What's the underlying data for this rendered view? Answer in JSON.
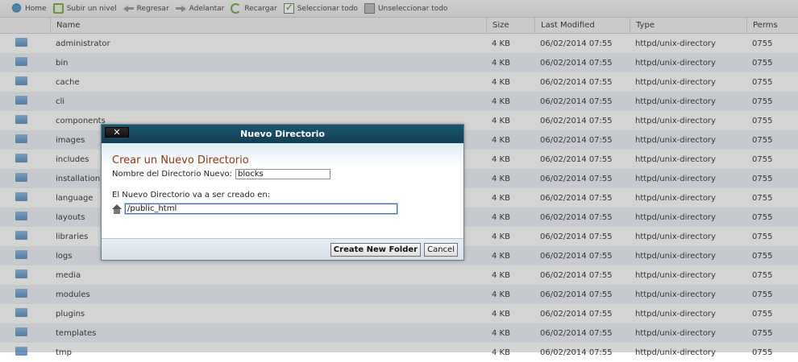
{
  "toolbar": {
    "items": [
      {
        "label": "Home",
        "icon": "home-icon"
      },
      {
        "label": "Subir un nivel",
        "icon": "up-level-icon"
      },
      {
        "label": "Regresar",
        "icon": "back-arrow-icon"
      },
      {
        "label": "Adelantar",
        "icon": "forward-arrow-icon"
      },
      {
        "label": "Recargar",
        "icon": "reload-icon"
      },
      {
        "label": "Seleccionar todo",
        "icon": "checkbox-checked-icon"
      },
      {
        "label": "Unseleccionar todo",
        "icon": "checkbox-unchecked-icon"
      }
    ]
  },
  "table": {
    "columns": [
      "Name",
      "Size",
      "Last Modified",
      "Type",
      "Perms"
    ],
    "rows": [
      {
        "name": "administrator",
        "size": "4 KB",
        "modified": "06/02/2014 07:55",
        "type": "httpd/unix-directory",
        "perms": "0755"
      },
      {
        "name": "bin",
        "size": "4 KB",
        "modified": "06/02/2014 07:55",
        "type": "httpd/unix-directory",
        "perms": "0755"
      },
      {
        "name": "cache",
        "size": "4 KB",
        "modified": "06/02/2014 07:55",
        "type": "httpd/unix-directory",
        "perms": "0755"
      },
      {
        "name": "cli",
        "size": "4 KB",
        "modified": "06/02/2014 07:55",
        "type": "httpd/unix-directory",
        "perms": "0755"
      },
      {
        "name": "components",
        "size": "4 KB",
        "modified": "06/02/2014 07:55",
        "type": "httpd/unix-directory",
        "perms": "0755"
      },
      {
        "name": "images",
        "size": "4 KB",
        "modified": "06/02/2014 07:55",
        "type": "httpd/unix-directory",
        "perms": "0755"
      },
      {
        "name": "includes",
        "size": "4 KB",
        "modified": "06/02/2014 07:55",
        "type": "httpd/unix-directory",
        "perms": "0755"
      },
      {
        "name": "installation",
        "size": "4 KB",
        "modified": "06/02/2014 07:55",
        "type": "httpd/unix-directory",
        "perms": "0755"
      },
      {
        "name": "language",
        "size": "4 KB",
        "modified": "06/02/2014 07:55",
        "type": "httpd/unix-directory",
        "perms": "0755"
      },
      {
        "name": "layouts",
        "size": "4 KB",
        "modified": "06/02/2014 07:55",
        "type": "httpd/unix-directory",
        "perms": "0755"
      },
      {
        "name": "libraries",
        "size": "4 KB",
        "modified": "06/02/2014 07:55",
        "type": "httpd/unix-directory",
        "perms": "0755"
      },
      {
        "name": "logs",
        "size": "4 KB",
        "modified": "06/02/2014 07:55",
        "type": "httpd/unix-directory",
        "perms": "0755"
      },
      {
        "name": "media",
        "size": "4 KB",
        "modified": "06/02/2014 07:55",
        "type": "httpd/unix-directory",
        "perms": "0755"
      },
      {
        "name": "modules",
        "size": "4 KB",
        "modified": "06/02/2014 07:55",
        "type": "httpd/unix-directory",
        "perms": "0755"
      },
      {
        "name": "plugins",
        "size": "4 KB",
        "modified": "06/02/2014 07:55",
        "type": "httpd/unix-directory",
        "perms": "0755"
      },
      {
        "name": "templates",
        "size": "4 KB",
        "modified": "06/02/2014 07:55",
        "type": "httpd/unix-directory",
        "perms": "0755"
      },
      {
        "name": "tmp",
        "size": "4 KB",
        "modified": "06/02/2014 07:55",
        "type": "httpd/unix-directory",
        "perms": "0755"
      }
    ]
  },
  "dialog": {
    "title": "Nuevo Directorio",
    "close_label": "✕",
    "heading": "Crear un Nuevo Directorio",
    "name_label": "Nombre del Directorio Nuevo:",
    "name_value": "blocks",
    "location_label": "El Nuevo Directorio va a ser creado en:",
    "path_value": "/public_html",
    "create_button": "Create New Folder",
    "cancel_button": "Cancel"
  }
}
